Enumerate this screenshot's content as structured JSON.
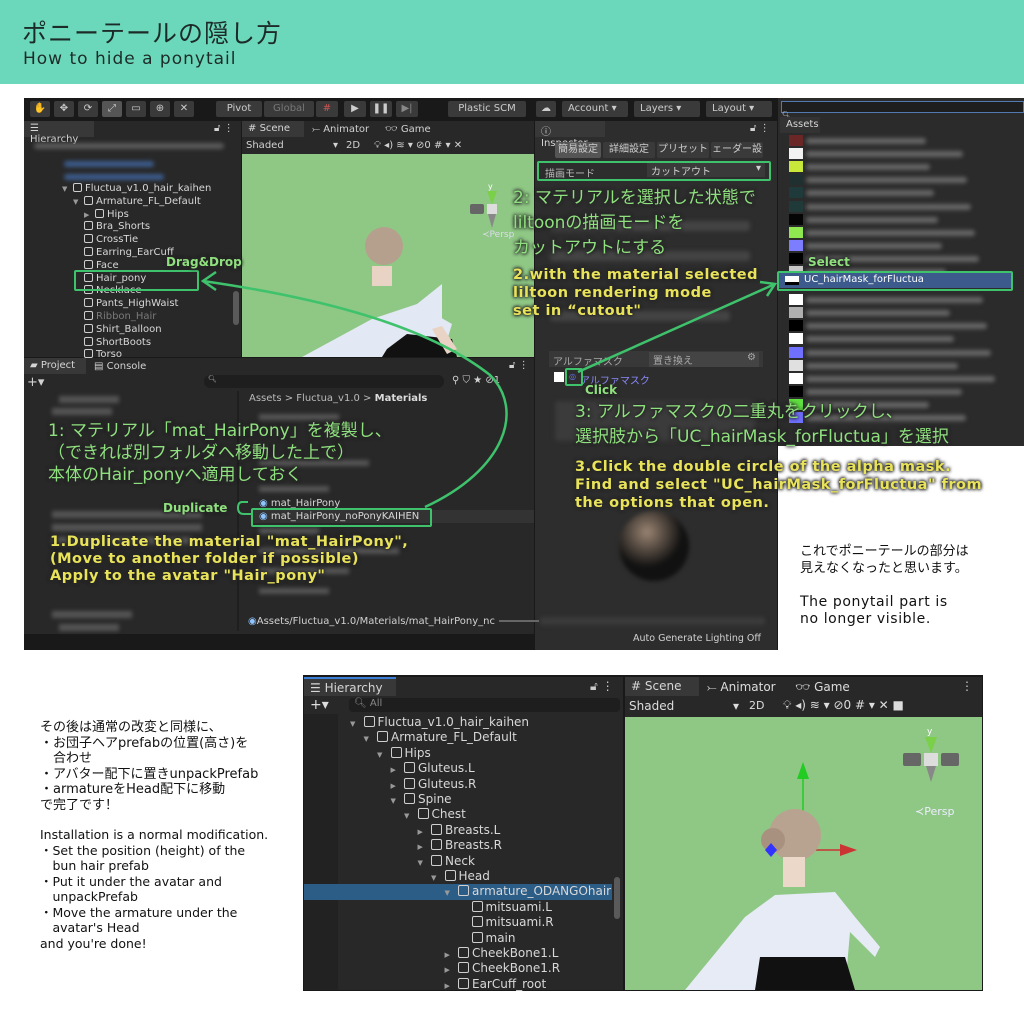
{
  "header": {
    "title": "ポニーテールの隠し方",
    "subtitle": "How to hide a ponytail",
    "bg": "#6cd8bb"
  },
  "toolbar": {
    "pivot": "Pivot",
    "global": "Global",
    "plastic": "Plastic SCM",
    "account": "Account",
    "layers": "Layers",
    "layout": "Layout"
  },
  "hierarchy_top": {
    "tab": "Hierarchy",
    "rows": [
      {
        "label": "Fluctua_v1.0_hair_kaihen",
        "depth": 0,
        "arrow": "down"
      },
      {
        "label": "Armature_FL_Default",
        "depth": 1,
        "arrow": "down"
      },
      {
        "label": "Hips",
        "depth": 2,
        "arrow": "right"
      },
      {
        "label": "Bra_Shorts",
        "depth": 1,
        "arrow": ""
      },
      {
        "label": "CrossTie",
        "depth": 1,
        "arrow": ""
      },
      {
        "label": "Earring_EarCuff",
        "depth": 1,
        "arrow": ""
      },
      {
        "label": "Face",
        "depth": 1,
        "arrow": ""
      },
      {
        "label": "Hair_pony",
        "depth": 1,
        "arrow": ""
      },
      {
        "label": "Necklace",
        "depth": 1,
        "arrow": ""
      },
      {
        "label": "Pants_HighWaist",
        "depth": 1,
        "arrow": ""
      },
      {
        "label": "Ribbon_Hair",
        "depth": 1,
        "arrow": "",
        "dim": true
      },
      {
        "label": "Shirt_Balloon",
        "depth": 1,
        "arrow": ""
      },
      {
        "label": "ShortBoots",
        "depth": 1,
        "arrow": ""
      },
      {
        "label": "Torso",
        "depth": 1,
        "arrow": ""
      }
    ]
  },
  "scene_top": {
    "tabs": [
      "Scene",
      "Animator",
      "Game"
    ],
    "shading": "Shaded",
    "mode2d": "2D",
    "hidden_count": "0",
    "persp": "Persp",
    "axis_y": "y"
  },
  "inspector": {
    "tab": "Inspector",
    "tabs": [
      "簡易設定",
      "詳細設定",
      "プリセット",
      "ェーダー設"
    ],
    "render_mode_label": "描画モード",
    "render_mode_value": "カットアウト",
    "alpha_mask_label": "アルファマスク",
    "alpha_mask_mode": "置き換え",
    "alpha_mask_field": "アルファマスク",
    "status": "Auto Generate Lighting Off"
  },
  "assets": {
    "tab": "Assets",
    "selected": "UC_hairMask_forFluctua",
    "swatches": [
      "#6b2626",
      "#f2f2f2",
      "#c8e83a",
      "#203030",
      "#1e3a3a",
      "#203a3a",
      "#050505",
      "#90e850",
      "#7d7dff",
      "#000000",
      "#c8c8c8",
      "#ffffff",
      "#b0b0b0",
      "#000000",
      "#ffffff",
      "#7070ff",
      "#e0e0e0",
      "#ffffff",
      "#000000",
      "#60e040",
      "#7070ff"
    ]
  },
  "project": {
    "tabs": [
      "Project",
      "Console"
    ],
    "breadcrumb": [
      "Assets",
      "Fluctua_v1.0",
      "Materials"
    ],
    "items": [
      "mat_HairPony",
      "mat_HairPony_noPonyKAIHEN"
    ],
    "path": "Assets/Fluctua_v1.0/Materials/mat_HairPony_nc",
    "hidden_count": "1"
  },
  "annotations": {
    "drag_drop": "Drag&Drop",
    "step1_jp": [
      "1: マテリアル「mat_HairPony」を複製し、",
      "（できれば別フォルダへ移動した上で）",
      "本体のHair_ponyへ適用しておく"
    ],
    "duplicate": "Duplicate",
    "step1_en": [
      "1.Duplicate the material \"mat_HairPony\",",
      "(Move to another folder if possible)",
      "Apply to the avatar \"Hair_pony\""
    ],
    "step2_jp": [
      "2: マテリアルを選択した状態で",
      "liltoonの描画モードを",
      "カットアウトにする"
    ],
    "step2_en": [
      "2.with the material selected",
      "liltoon rendering mode",
      "set in  “cutout\""
    ],
    "select": "Select",
    "click": "Click",
    "step3_jp": [
      "3: アルファマスクの二重丸をクリックし、",
      "選択肢から「UC_hairMask_forFluctua」を選択"
    ],
    "step3_en": [
      "3.Click the double circle of the alpha mask.",
      "Find and select \"UC_hairMask_forFluctua\" from",
      "the options that open."
    ],
    "green": "#3fc26c",
    "yellow": "#e9e35a"
  },
  "result_note": {
    "jp": "これでポニーテールの部分は\n見えなくなったと思います。",
    "en": "The ponytail part is\nno longer visible."
  },
  "install_note": {
    "jp": "その後は通常の改変と同様に、\n・お団子ヘアprefabの位置(高さ)を\n　合わせ\n・アバター配下に置きunpackPrefab\n・armatureをHead配下に移動\nで完了です！",
    "en": "Installation is a normal modification.\n・Set the position (height) of the\n　bun hair prefab\n・Put it under the avatar and\n　unpackPrefab\n・Move the armature under the\n　avatar's Head\nand you're done!"
  },
  "hierarchy_bottom": {
    "tab": "Hierarchy",
    "search": "All",
    "rows": [
      {
        "label": "Fluctua_v1.0_hair_kaihen",
        "depth": 0,
        "arrow": "down"
      },
      {
        "label": "Armature_FL_Default",
        "depth": 1,
        "arrow": "down"
      },
      {
        "label": "Hips",
        "depth": 2,
        "arrow": "down"
      },
      {
        "label": "Gluteus.L",
        "depth": 3,
        "arrow": "right"
      },
      {
        "label": "Gluteus.R",
        "depth": 3,
        "arrow": "right"
      },
      {
        "label": "Spine",
        "depth": 3,
        "arrow": "down"
      },
      {
        "label": "Chest",
        "depth": 4,
        "arrow": "down"
      },
      {
        "label": "Breasts.L",
        "depth": 5,
        "arrow": "right"
      },
      {
        "label": "Breasts.R",
        "depth": 5,
        "arrow": "right"
      },
      {
        "label": "Neck",
        "depth": 5,
        "arrow": "down"
      },
      {
        "label": "Head",
        "depth": 6,
        "arrow": "down"
      },
      {
        "label": "armature_ODANGOhair",
        "depth": 7,
        "arrow": "down",
        "selected": true
      },
      {
        "label": "mitsuami.L",
        "depth": 8,
        "arrow": ""
      },
      {
        "label": "mitsuami.R",
        "depth": 8,
        "arrow": ""
      },
      {
        "label": "main",
        "depth": 8,
        "arrow": ""
      },
      {
        "label": "CheekBone1.L",
        "depth": 7,
        "arrow": "right"
      },
      {
        "label": "CheekBone1.R",
        "depth": 7,
        "arrow": "right"
      },
      {
        "label": "EarCuff_root",
        "depth": 7,
        "arrow": "right"
      }
    ]
  },
  "scene_bottom": {
    "tabs": [
      "Scene",
      "Animator",
      "Game"
    ],
    "shading": "Shaded",
    "mode2d": "2D",
    "hidden_count": "0",
    "persp": "Persp",
    "axis_y": "y"
  }
}
